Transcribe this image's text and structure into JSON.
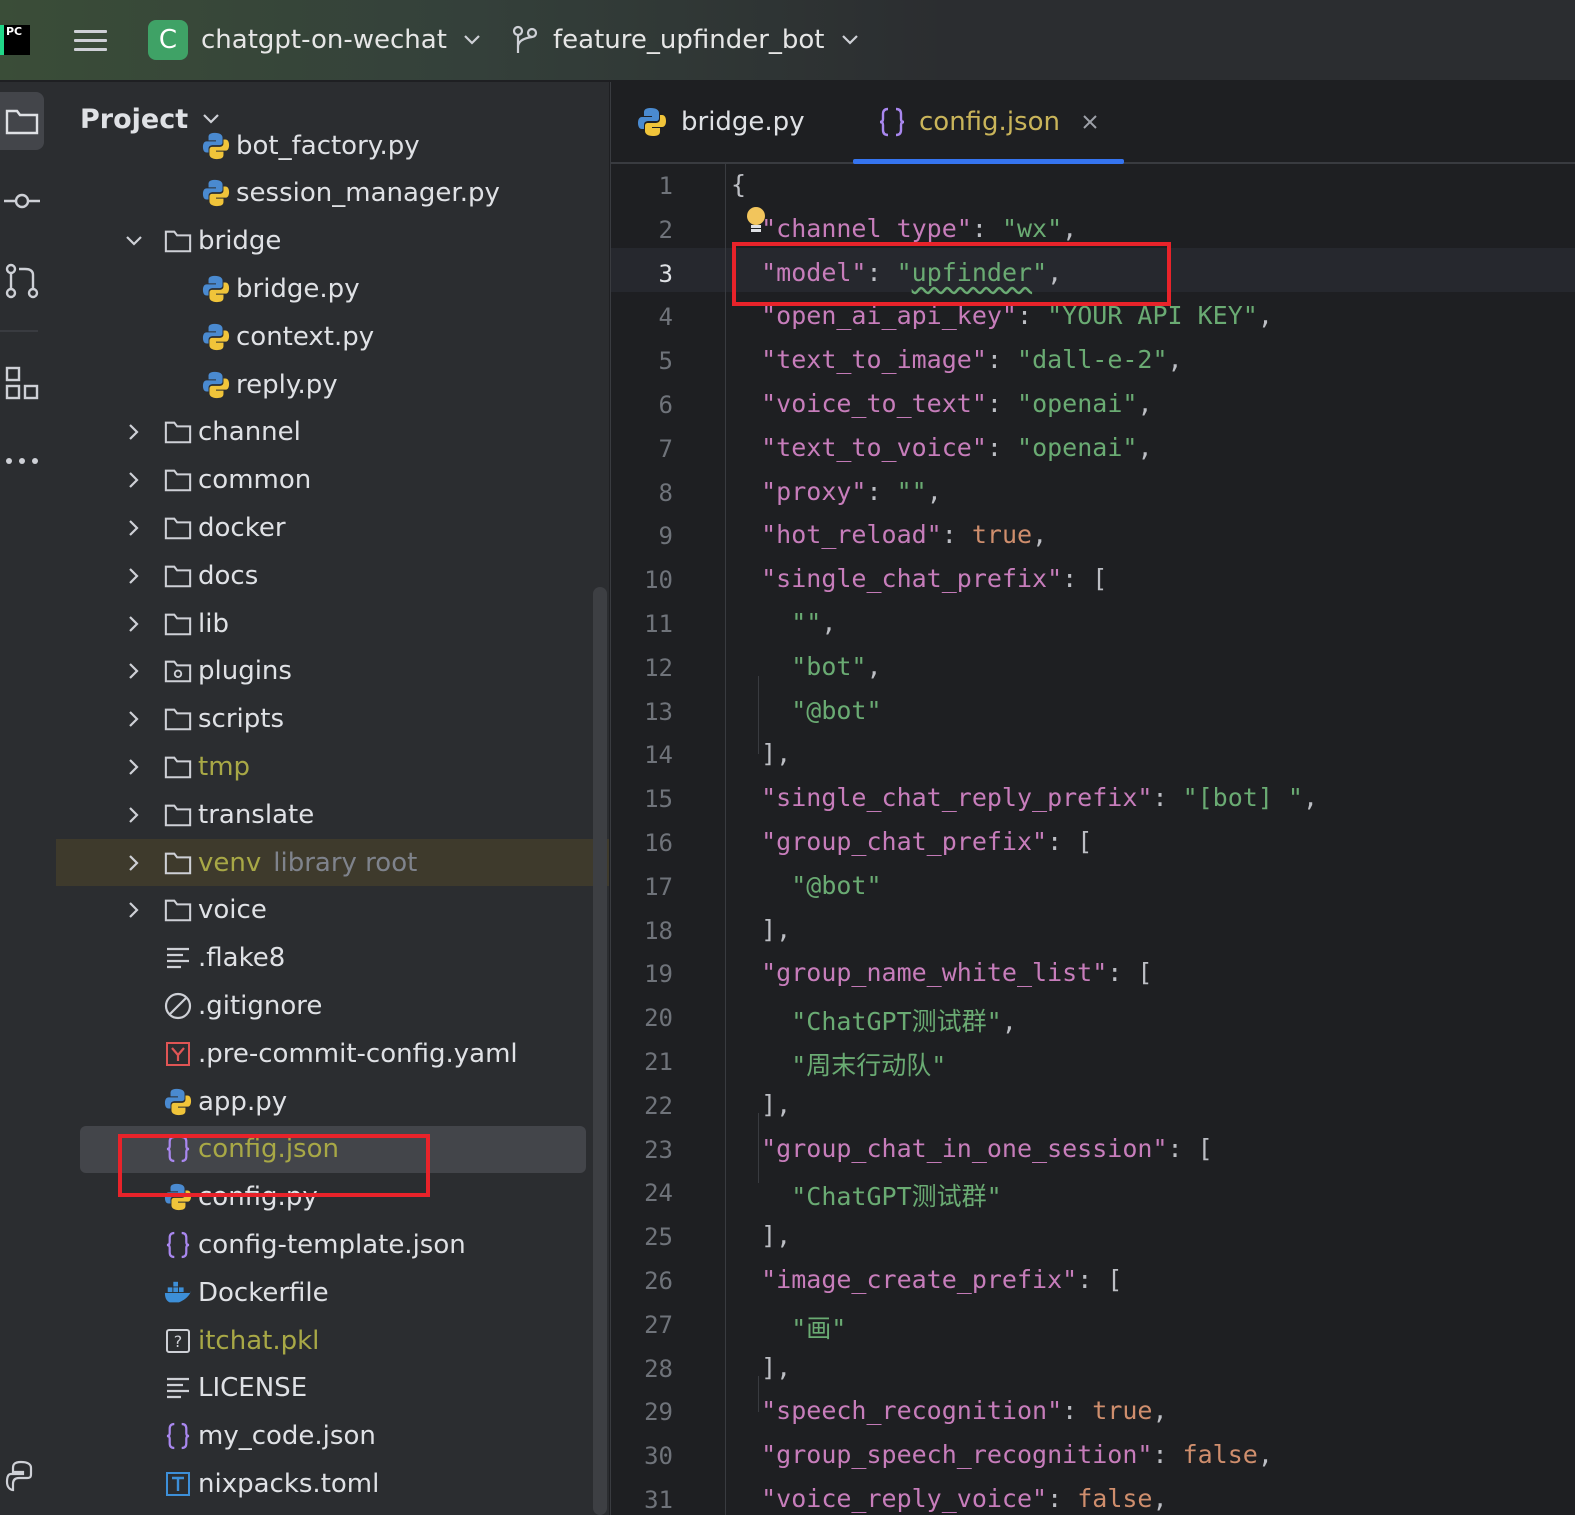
{
  "titlebar": {
    "logo_text": "PC",
    "project_initial": "C",
    "project_name": "chatgpt-on-wechat",
    "branch_name": "feature_upfinder_bot"
  },
  "project_panel": {
    "title": "Project",
    "tree": [
      {
        "label": "bot_factory.py",
        "type": "python",
        "depth": 2
      },
      {
        "label": "session_manager.py",
        "type": "python",
        "depth": 2
      },
      {
        "label": "bridge",
        "type": "folder",
        "depth": 1,
        "expanded": true
      },
      {
        "label": "bridge.py",
        "type": "python",
        "depth": 2
      },
      {
        "label": "context.py",
        "type": "python",
        "depth": 2
      },
      {
        "label": "reply.py",
        "type": "python",
        "depth": 2
      },
      {
        "label": "channel",
        "type": "folder",
        "depth": 1
      },
      {
        "label": "common",
        "type": "folder",
        "depth": 1
      },
      {
        "label": "docker",
        "type": "folder",
        "depth": 1
      },
      {
        "label": "docs",
        "type": "folder",
        "depth": 1
      },
      {
        "label": "lib",
        "type": "folder",
        "depth": 1
      },
      {
        "label": "plugins",
        "type": "folder-plugin",
        "depth": 1
      },
      {
        "label": "scripts",
        "type": "folder",
        "depth": 1
      },
      {
        "label": "tmp",
        "type": "folder",
        "depth": 1,
        "excluded": true
      },
      {
        "label": "translate",
        "type": "folder",
        "depth": 1
      },
      {
        "label": "venv",
        "type": "folder",
        "depth": 1,
        "excluded": true,
        "sublabel": "library root"
      },
      {
        "label": "voice",
        "type": "folder",
        "depth": 1
      },
      {
        "label": ".flake8",
        "type": "text",
        "depth": 1
      },
      {
        "label": ".gitignore",
        "type": "ignore",
        "depth": 1
      },
      {
        "label": ".pre-commit-config.yaml",
        "type": "yaml",
        "depth": 1
      },
      {
        "label": "app.py",
        "type": "python",
        "depth": 1
      },
      {
        "label": "config.json",
        "type": "json",
        "depth": 1,
        "excluded": true,
        "selected": true
      },
      {
        "label": "config.py",
        "type": "python",
        "depth": 1
      },
      {
        "label": "config-template.json",
        "type": "json",
        "depth": 1
      },
      {
        "label": "Dockerfile",
        "type": "docker",
        "depth": 1
      },
      {
        "label": "itchat.pkl",
        "type": "unknown",
        "depth": 1,
        "excluded": true
      },
      {
        "label": "LICENSE",
        "type": "text",
        "depth": 1
      },
      {
        "label": "my_code.json",
        "type": "json",
        "depth": 1
      },
      {
        "label": "nixpacks.toml",
        "type": "toml",
        "depth": 1
      }
    ]
  },
  "editor": {
    "tabs": [
      {
        "label": "bridge.py",
        "icon": "python-icon",
        "active": false
      },
      {
        "label": "config.json",
        "icon": "json-icon",
        "active": true
      }
    ],
    "current_line": 3,
    "lines": [
      "{",
      "  \"channel_type\": \"wx\",",
      "  \"model\": \"upfinder\",",
      "  \"open_ai_api_key\": \"YOUR API KEY\",",
      "  \"text_to_image\": \"dall-e-2\",",
      "  \"voice_to_text\": \"openai\",",
      "  \"text_to_voice\": \"openai\",",
      "  \"proxy\": \"\",",
      "  \"hot_reload\": true,",
      "  \"single_chat_prefix\": [",
      "    \"\",",
      "    \"bot\",",
      "    \"@bot\"",
      "  ],",
      "  \"single_chat_reply_prefix\": \"[bot] \",",
      "  \"group_chat_prefix\": [",
      "    \"@bot\"",
      "  ],",
      "  \"group_name_white_list\": [",
      "    \"ChatGPT测试群\",",
      "    \"周末行动队\"",
      "  ],",
      "  \"group_chat_in_one_session\": [",
      "    \"ChatGPT测试群\"",
      "  ],",
      "  \"image_create_prefix\": [",
      "    \"画\"",
      "  ],",
      "  \"speech_recognition\": true,",
      "  \"group_speech_recognition\": false,",
      "  \"voice_reply_voice\": false,"
    ]
  },
  "colors": {
    "key": "#c77dbb",
    "string": "#6aab73",
    "keyword": "#cf8e6d",
    "excluded": "#a8a846",
    "accent": "#3574f0",
    "highlight_box": "#e8232a"
  }
}
